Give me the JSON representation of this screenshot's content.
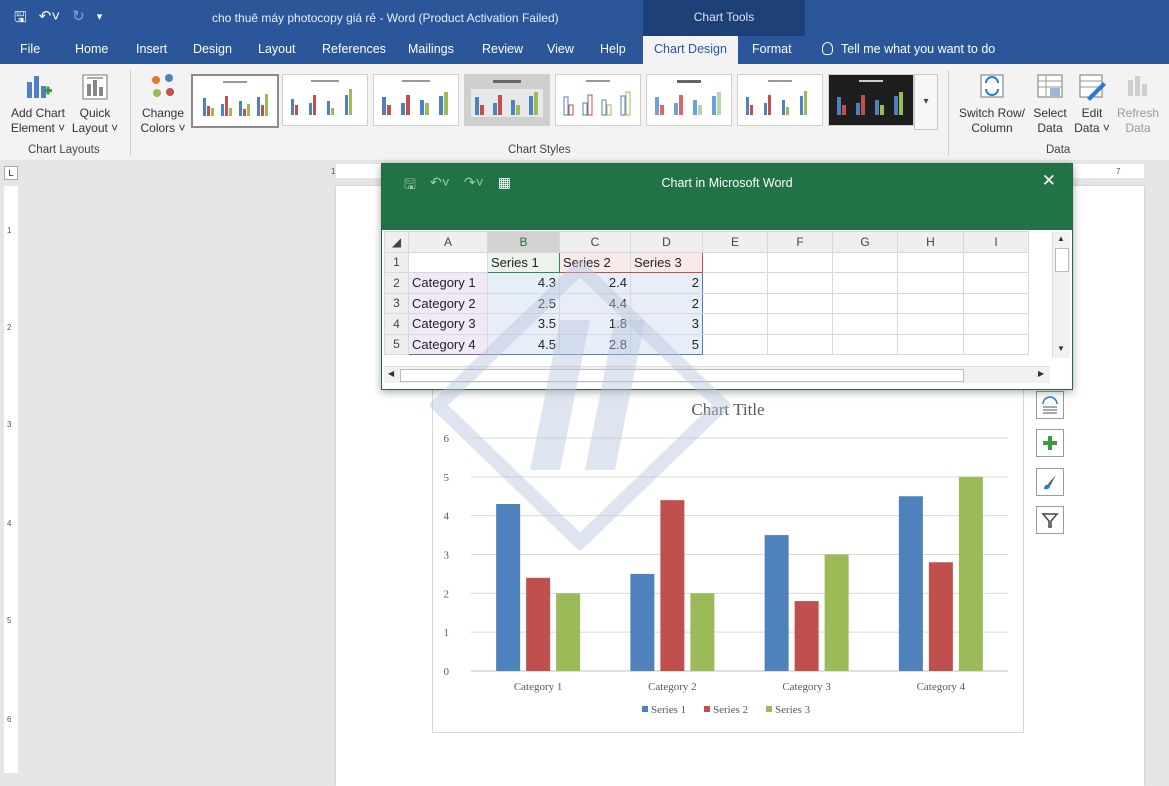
{
  "app": {
    "doc_title": "cho thuê máy photocopy giá rẻ  -  Word (Product Activation Failed)",
    "contextual_group": "Chart Tools"
  },
  "tabs": [
    "File",
    "Home",
    "Insert",
    "Design",
    "Layout",
    "References",
    "Mailings",
    "Review",
    "View",
    "Help",
    "Chart Design",
    "Format"
  ],
  "active_tab": "Chart Design",
  "tell_me": "Tell me what you want to do",
  "ribbon": {
    "add_chart": [
      "Add Chart",
      "Element ˅"
    ],
    "quick_layout": [
      "Quick",
      "Layout ˅"
    ],
    "group_chart_layouts": "Chart Layouts",
    "change_colors": [
      "Change",
      "Colors ˅"
    ],
    "group_chart_styles": "Chart Styles",
    "switch_row": [
      "Switch Row/",
      "Column"
    ],
    "select_data": [
      "Select",
      "Data"
    ],
    "edit_data": [
      "Edit",
      "Data ˅"
    ],
    "refresh_data": [
      "Refresh",
      "Data"
    ],
    "group_data": "Data"
  },
  "ruler": {
    "h_marks": [
      "1",
      "7"
    ],
    "v_marks": [
      "1",
      "2",
      "3",
      "4",
      "5",
      "6"
    ]
  },
  "datasheet": {
    "title": "Chart in Microsoft Word",
    "columns": [
      "A",
      "B",
      "C",
      "D",
      "E",
      "F",
      "G",
      "H",
      "I"
    ],
    "rows": [
      {
        "n": "1",
        "cells": [
          "",
          "Series 1",
          "Series 2",
          "Series 3"
        ]
      },
      {
        "n": "2",
        "cells": [
          "Category 1",
          "4.3",
          "2.4",
          "2"
        ]
      },
      {
        "n": "3",
        "cells": [
          "Category 2",
          "2.5",
          "4.4",
          "2"
        ]
      },
      {
        "n": "4",
        "cells": [
          "Category 3",
          "3.5",
          "1.8",
          "3"
        ]
      },
      {
        "n": "5",
        "cells": [
          "Category 4",
          "4.5",
          "2.8",
          "5"
        ]
      }
    ]
  },
  "chart_data": {
    "type": "bar",
    "title": "Chart Title",
    "categories": [
      "Category 1",
      "Category 2",
      "Category 3",
      "Category 4"
    ],
    "series": [
      {
        "name": "Series 1",
        "values": [
          4.3,
          2.5,
          3.5,
          4.5
        ],
        "color": "#4f81bd"
      },
      {
        "name": "Series 2",
        "values": [
          2.4,
          4.4,
          1.8,
          2.8
        ],
        "color": "#c0504d"
      },
      {
        "name": "Series 3",
        "values": [
          2,
          2,
          3,
          5
        ],
        "color": "#9bbb59"
      }
    ],
    "ylim": [
      0,
      6
    ],
    "yticks": [
      0,
      1,
      2,
      3,
      4,
      5,
      6
    ],
    "grid": true,
    "legend": "bottom"
  }
}
